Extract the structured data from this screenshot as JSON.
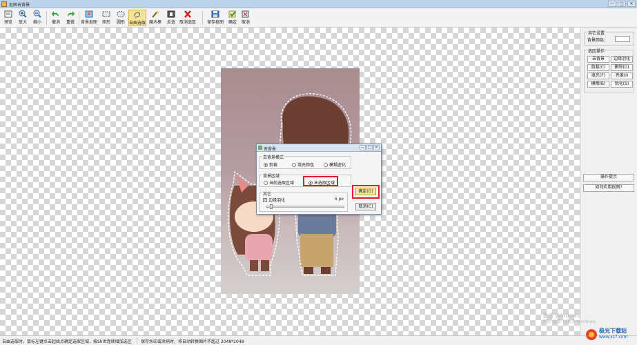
{
  "window": {
    "title": "抠图去背景",
    "buttons": [
      "—",
      "□",
      "✕"
    ]
  },
  "toolbar": {
    "items": [
      {
        "label": "预览",
        "icon": "preview-icon"
      },
      {
        "label": "放大",
        "icon": "zoom-in-icon"
      },
      {
        "label": "缩小",
        "icon": "zoom-out-icon"
      },
      {
        "label": "撤消",
        "icon": "undo-icon"
      },
      {
        "label": "重做",
        "icon": "redo-icon"
      },
      {
        "label": "背景抠图",
        "icon": "background-cutout-icon"
      },
      {
        "label": "矩形",
        "icon": "rectangle-icon"
      },
      {
        "label": "圆形",
        "icon": "circle-icon"
      },
      {
        "label": "自由选取",
        "icon": "freehand-select-icon"
      },
      {
        "label": "魔术棒",
        "icon": "magic-wand-icon"
      },
      {
        "label": "反选",
        "icon": "invert-selection-icon"
      },
      {
        "label": "取消选区",
        "icon": "cancel-selection-icon"
      },
      {
        "label": "保存抠图",
        "icon": "save-cutout-icon"
      },
      {
        "label": "确定",
        "icon": "confirm-icon"
      },
      {
        "label": "取消",
        "icon": "cancel-icon"
      }
    ]
  },
  "dialog": {
    "title": "去背景",
    "mode": {
      "title": "去背景模式",
      "options": [
        "剪裁",
        "填充颜色",
        "模糊虚化"
      ],
      "selected": "剪裁"
    },
    "area": {
      "title": "背景区域",
      "options": [
        "当前选取区域",
        "未选取区域"
      ],
      "selected": "未选取区域"
    },
    "other": {
      "title": "其它",
      "feather_label": "边缘羽化",
      "feather_checked": true,
      "feather_value": "5 px",
      "feather_level": 0.05
    },
    "ok_label": "确定(O)",
    "cancel_label": "取消(C)"
  },
  "panel": {
    "other_settings": {
      "title": "其它设置",
      "bg_color_label": "背景颜色：",
      "bg_color": "#ffffff"
    },
    "selection_ops": {
      "title": "选区操作",
      "buttons": [
        "去背景",
        "边缘羽化",
        "剪裁(C)",
        "删除(D)",
        "填充(F)",
        "亮度(I)",
        "模糊(B)",
        "锐化(S)"
      ]
    },
    "tips_label": "操作提示",
    "howto_label": "如何应用抠图?"
  },
  "status": {
    "left": "自由选取时，鼠标左键点击起始点确定选取区域，按Shift连续增加选区",
    "right": "保存水印或涂鸦时，将自动转换图片不超过 2048*2048"
  },
  "watermark": {
    "line1": "激活 Windows",
    "line2": "转到\"设置\"以激活 Windows。"
  },
  "logo": {
    "line1": "极光下载站",
    "line2": "www.xz7.com"
  },
  "colors": {
    "accent": "#d8202a",
    "active_tool": "#f7e29a",
    "selection_dash": "#ffffff"
  }
}
